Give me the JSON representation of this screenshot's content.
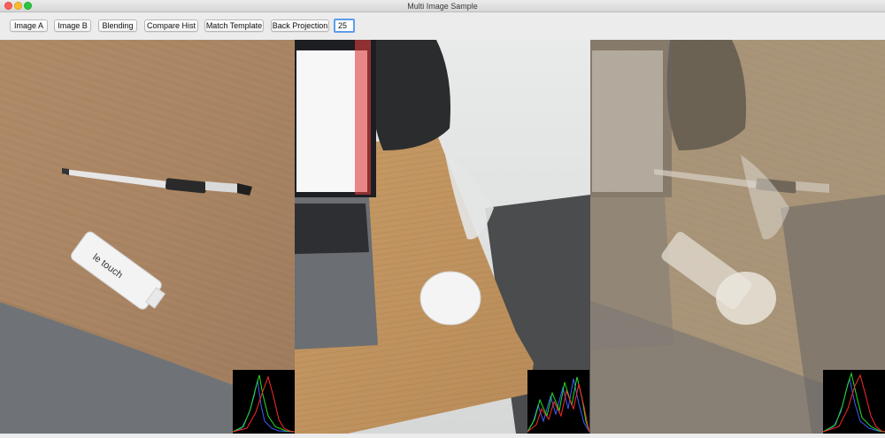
{
  "window": {
    "title": "Multi Image Sample"
  },
  "toolbar": {
    "buttons": [
      {
        "label": "Image A"
      },
      {
        "label": "Image B"
      },
      {
        "label": "Blending"
      },
      {
        "label": "Compare Hist"
      },
      {
        "label": "Match Template"
      },
      {
        "label": "Back Projection"
      }
    ],
    "value_input": {
      "value": "25"
    }
  },
  "panels": [
    {
      "name": "image-a",
      "content": "wooden desk with pen and le touch usb stick"
    },
    {
      "name": "image-b",
      "content": "laptop, backpack and white mouse on wooden desk"
    },
    {
      "name": "blended",
      "content": "blend of image a and image b"
    }
  ],
  "logo_text": "le touch",
  "colors": {
    "input_focus": "#5b9dea",
    "hist_red": "#ff2a2a",
    "hist_green": "#22e022",
    "hist_blue": "#3a5cff"
  }
}
